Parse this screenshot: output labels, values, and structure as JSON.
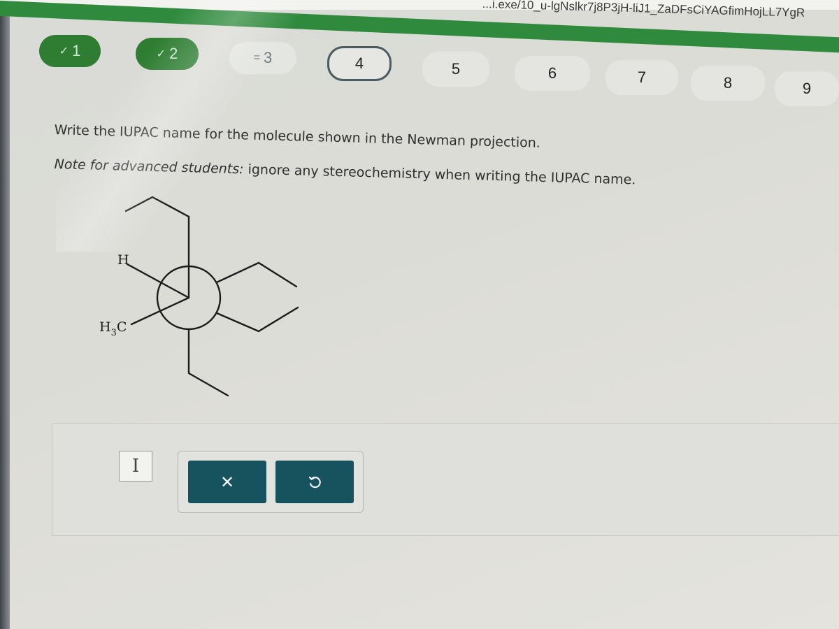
{
  "browser": {
    "url_fragment": "...i.exe/10_u-lgNslkr7j8P3jH-liJ1_ZaDFsCiYAGfimHojLL7YgR"
  },
  "steps": [
    {
      "label": "1",
      "state": "done",
      "icon": "check-icon",
      "glyph": "✓"
    },
    {
      "label": "2",
      "state": "done",
      "icon": "check-icon",
      "glyph": "✓"
    },
    {
      "label": "3",
      "state": "partial",
      "icon": "partial-icon",
      "glyph": "="
    },
    {
      "label": "4",
      "state": "current"
    },
    {
      "label": "5",
      "state": "todo"
    },
    {
      "label": "6",
      "state": "todo"
    },
    {
      "label": "7",
      "state": "todo"
    },
    {
      "label": "8",
      "state": "todo"
    },
    {
      "label": "9",
      "state": "todo"
    }
  ],
  "question": {
    "prompt": "Write the IUPAC name for the molecule shown in the Newman projection.",
    "note_label": "Note for advanced students:",
    "note_text": "ignore any stereochemistry when writing the IUPAC name."
  },
  "newman": {
    "labels": {
      "h": "H",
      "h3c_main": "H",
      "h3c_sub": "3",
      "h3c_tail": "C"
    }
  },
  "answer": {
    "value": "",
    "cursor_icon": "text-cursor-icon",
    "cursor_glyph": "I"
  },
  "tools": {
    "clear": {
      "icon": "close-icon",
      "glyph": "✕"
    },
    "undo": {
      "icon": "undo-icon"
    }
  },
  "colors": {
    "step_done": "#2e7d32",
    "step_current_border": "#4b5b61",
    "button": "#17535e",
    "green_bar": "#2f8a3d"
  }
}
